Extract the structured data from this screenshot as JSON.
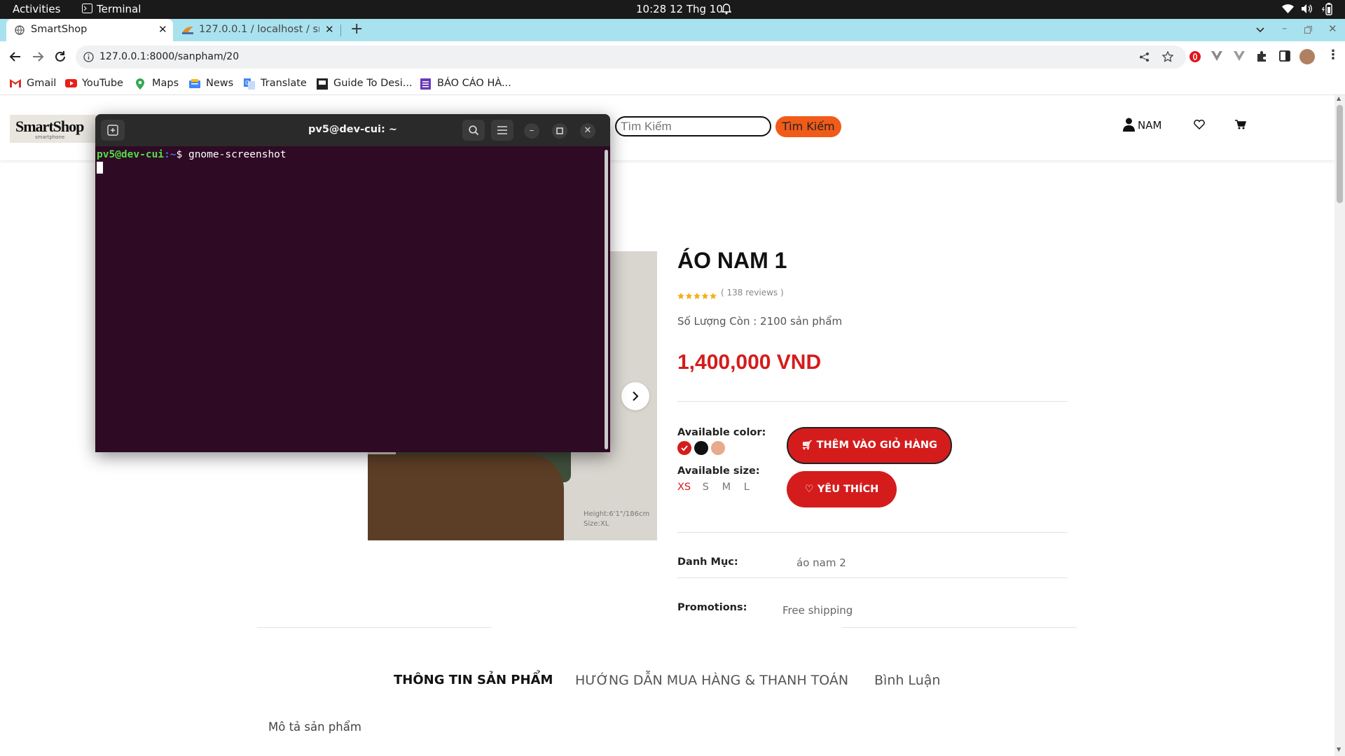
{
  "system": {
    "activities": "Activities",
    "app_name": "Terminal",
    "clock": "10:28  12 Thg 10"
  },
  "browser": {
    "tabs": [
      {
        "title": "SmartShop"
      },
      {
        "title": "127.0.0.1 / localhost / sm"
      }
    ],
    "url": "127.0.0.1:8000/sanpham/20",
    "bookmarks": [
      "Gmail",
      "YouTube",
      "Maps",
      "News",
      "Translate",
      "Guide To Desi...",
      "BÁO CÁO HÀ..."
    ]
  },
  "site": {
    "logo": "SmartShop",
    "logo_sub": "smartphone",
    "search_placeholder": "Tìm Kiếm",
    "search_button": "Tìm Kiếm",
    "user_label": "NAM",
    "product": {
      "title": "ÁO NAM 1",
      "reviews": "( 138 reviews )",
      "stock": "Số Lượng Còn : 2100 sản phẩm",
      "price": "1,400,000 VND",
      "color_label": "Available color:",
      "colors": [
        "#d51c1c",
        "#111111",
        "#e8a98c"
      ],
      "size_label": "Available size:",
      "sizes": [
        "XS",
        "S",
        "M",
        "L"
      ],
      "add_cart": "THÊM VÀO GIỎ HÀNG",
      "wishlist": "YÊU THÍCH",
      "category_label": "Danh Mục:",
      "category_value": "áo nam 2",
      "promo_label": "Promotions:",
      "promo_value": "Free shipping",
      "image_caption_1": "Height:6'1\"/186cm",
      "image_caption_2": "Size:XL",
      "rating_stars": 5
    },
    "info_tabs": [
      "THÔNG TIN SẢN PHẨM",
      "HƯỚNG DẪN MUA HÀNG & THANH TOÁN",
      "Bình Luận"
    ],
    "description_label": "Mô tả sản phẩm"
  },
  "terminal": {
    "title": "pv5@dev-cui: ~",
    "prompt_user": "pv5@dev-cui",
    "prompt_path": ":~",
    "prompt_symbol": "$",
    "command": "gnome-screenshot"
  }
}
